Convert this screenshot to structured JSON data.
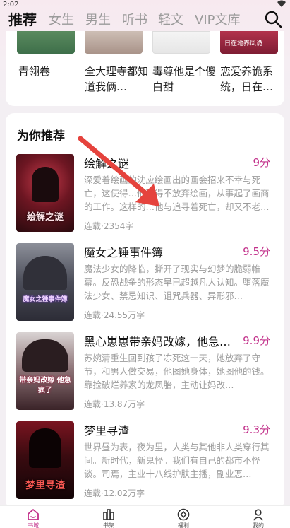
{
  "status": {
    "time": "2:02"
  },
  "nav": {
    "tabs": [
      "推荐",
      "女生",
      "男生",
      "听书",
      "轻文",
      "VIP文库"
    ],
    "active": "推荐"
  },
  "top_books": [
    {
      "title": "青翎卷"
    },
    {
      "title": "全大理寺都知道我俩…"
    },
    {
      "title": "毒尊他是个傻白甜"
    },
    {
      "title": "恋爱养诡系统，日在…",
      "cover_text": "日在地养风诡"
    }
  ],
  "recommend": {
    "heading": "为你推荐",
    "books": [
      {
        "title": "绘解之谜",
        "score": "9分",
        "desc": "深爱着绘画的沈应绘画出的画会招来不幸与死亡，这使得…他不得不放弃绘画，从事起了画商的工作。这样的…他与追寻着死亡，却又不老…",
        "meta": "连载·2354字",
        "cover_text": "绘解之谜"
      },
      {
        "title": "魔女之锤事件簿",
        "score": "9.5分",
        "desc": "魔法少女的降临，撕开了现实与幻梦的脆弱帷幕。反恐战争的形态早已超越凡人认知。堕落魔法少女、禁忌知识、诅咒兵器、异形邪…",
        "meta": "连载·24.55万字",
        "cover_text": "魔女之锤事件簿"
      },
      {
        "title": "黑心崽崽带亲妈改嫁，他急…",
        "score": "9.9分",
        "desc": "苏婉清重生回到孩子冻死这一天，她放弃了守节，和男人做交易，他图她身体，她图他的钱。靠捡破烂养家的龙凤胎，主动让妈改…",
        "meta": "连载·13.87万字",
        "cover_text": "带亲妈改嫁 他急疯了"
      },
      {
        "title": "梦里寻渣",
        "score": "9.3分",
        "desc": "世界昼为表，夜为里，人类与其他非人类穿行其间。新时代，新鬼怪。我们有自己的都市不怪谈。司焉，主业十八线护肤主播，副业恶…",
        "meta": "连载·12.02万字",
        "cover_text": "梦里寻渣"
      }
    ]
  },
  "bottom_nav": {
    "items": [
      "书城",
      "书架",
      "福利",
      "我的"
    ],
    "active": "书城"
  },
  "colors": {
    "accent": "#c2308a",
    "arrow": "#e5433d",
    "muted_text": "#9c9c9c"
  }
}
